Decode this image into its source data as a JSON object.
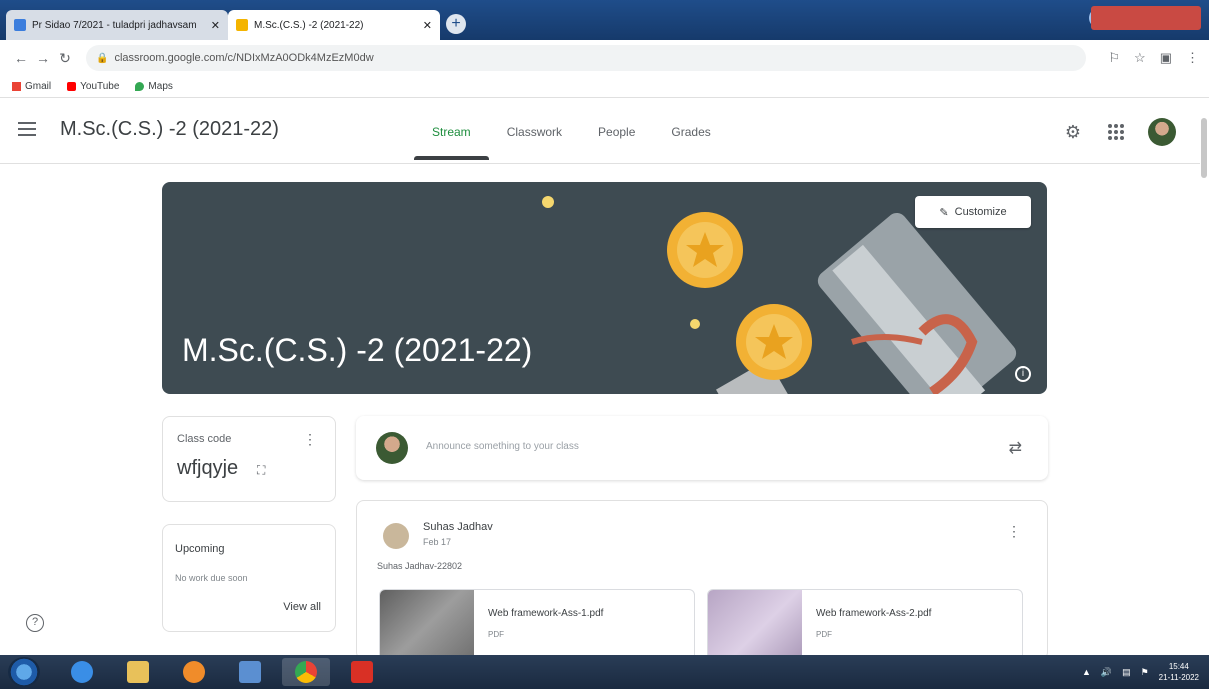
{
  "browser": {
    "tabs": [
      {
        "title": "Pr Sidao 7/2021 - tuladpri jadhavsam",
        "active": false
      },
      {
        "title": "M.Sc.(C.S.) -2 (2021-22)",
        "active": true
      }
    ],
    "url": "classroom.google.com/c/NDIxMzA0ODk4MzEzM0dw",
    "bookmarks": [
      "Gmail",
      "YouTube",
      "Maps"
    ]
  },
  "header": {
    "class_name": "M.Sc.(C.S.) -2 (2021-22)",
    "tabs": [
      "Stream",
      "Classwork",
      "People",
      "Grades"
    ],
    "active_tab": "Stream"
  },
  "banner": {
    "title": "M.Sc.(C.S.) -2 (2021-22)",
    "customize_label": "Customize",
    "bg_color": "#3e4b52"
  },
  "class_code": {
    "label": "Class code",
    "value": "wfjqyje"
  },
  "upcoming": {
    "title": "Upcoming",
    "empty_text": "No work due soon",
    "view_all": "View all"
  },
  "announce": {
    "placeholder": "Announce something to your class"
  },
  "post": {
    "author": "Suhas Jadhav",
    "date": "Feb 17",
    "text": "Suhas Jadhav-22802",
    "attachments": [
      {
        "name": "Web framework-Ass-1.pdf",
        "type": "PDF"
      },
      {
        "name": "Web framework-Ass-2.pdf",
        "type": "PDF"
      }
    ]
  },
  "taskbar": {
    "time": "15:44",
    "date": "21-11-2022"
  },
  "colors": {
    "accent_green": "#1e8e3e",
    "banner_coin": "#f2b134",
    "banner_ribbon": "#c8634a"
  },
  "icons": [
    "menu-icon",
    "gear-icon",
    "apps-grid-icon",
    "avatar",
    "pencil-icon",
    "info-icon",
    "more-vert-icon",
    "expand-icon",
    "repost-icon",
    "help-icon"
  ]
}
